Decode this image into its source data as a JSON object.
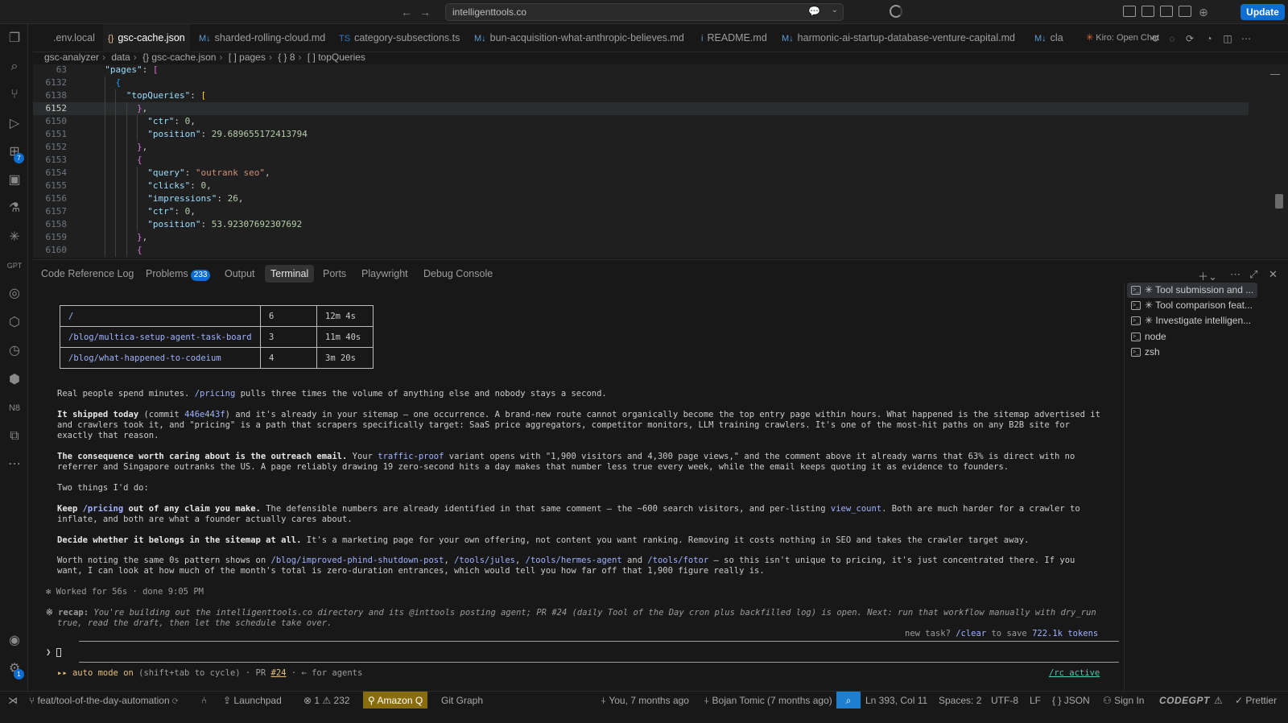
{
  "titlebar": {
    "search_text": "intelligenttools.co",
    "update_label": "Update"
  },
  "activity": {
    "extensions_badge": "7",
    "settings_badge": "1"
  },
  "tabs": [
    {
      "label": ".env.local",
      "icon": "",
      "active": false
    },
    {
      "label": "gsc-cache.json",
      "icon": "{}",
      "active": true
    },
    {
      "label": "sharded-rolling-cloud.md",
      "icon": "M↓",
      "active": false
    },
    {
      "label": "category-subsections.ts",
      "icon": "TS",
      "active": false
    },
    {
      "label": "bun-acquisition-what-anthropic-believes.md",
      "icon": "M↓",
      "active": false
    },
    {
      "label": "README.md",
      "icon": "i",
      "active": false
    },
    {
      "label": "harmonic-ai-startup-database-venture-capital.md",
      "icon": "M↓",
      "active": false
    },
    {
      "label": "cla",
      "icon": "M↓",
      "active": false
    }
  ],
  "kiro_tab": "Kiro: Open Chat",
  "breadcrumb": [
    "gsc-analyzer",
    "data",
    "{} gsc-cache.json",
    "[ ] pages",
    "{ } 8",
    "[ ] topQueries"
  ],
  "editor": {
    "lines": [
      {
        "n": "63",
        "text": "  \"pages\": ["
      },
      {
        "n": "6132",
        "text": "    {"
      },
      {
        "n": "6138",
        "text": "      \"topQueries\": ["
      },
      {
        "n": "6152",
        "text": "        },"
      },
      {
        "n": "6150",
        "text": "          \"ctr\": 0,"
      },
      {
        "n": "6151",
        "text": "          \"position\": 29.689655172413794"
      },
      {
        "n": "6152",
        "text": "        },"
      },
      {
        "n": "6153",
        "text": "        {"
      },
      {
        "n": "6154",
        "text": "          \"query\": \"outrank seo\","
      },
      {
        "n": "6155",
        "text": "          \"clicks\": 0,"
      },
      {
        "n": "6156",
        "text": "          \"impressions\": 26,"
      },
      {
        "n": "6157",
        "text": "          \"ctr\": 0,"
      },
      {
        "n": "6158",
        "text": "          \"position\": 53.92307692307692"
      },
      {
        "n": "6159",
        "text": "        },"
      },
      {
        "n": "6160",
        "text": "        {"
      }
    ]
  },
  "panel": {
    "tabs": [
      "Code Reference Log",
      "Problems",
      "Output",
      "Terminal",
      "Ports",
      "Playwright",
      "Debug Console"
    ],
    "problems_count": "233",
    "active_tab": "Terminal"
  },
  "terminal": {
    "table": [
      [
        "/",
        "6",
        "12m 4s"
      ],
      [
        "/blog/multica-setup-agent-task-board",
        "3",
        "11m 40s"
      ],
      [
        "/blog/what-happened-to-codeium",
        "4",
        "3m 20s"
      ]
    ],
    "p1_a": "Real people spend minutes. ",
    "p1_link": "/pricing",
    "p1_b": " pulls three times the volume of anything else and nobody stays a second.",
    "p2_bold": "It shipped today",
    "p2_a": " (commit ",
    "p2_commit": "446e443f",
    "p2_b": ") and it's already in your sitemap — one occurrence. A brand-new route cannot organically become the top entry page within hours. What happened is the sitemap advertised it",
    "p2_c": "and crawlers took it, and \"pricing\" is a path that scrapers specifically target: SaaS price aggregators, competitor monitors, LLM training crawlers. It's one of the most-hit paths on any B2B site for",
    "p2_d": "exactly that reason.",
    "p3_bold": "The consequence worth caring about is the outreach email.",
    "p3_a": " Your ",
    "p3_link": "traffic-proof",
    "p3_b": " variant opens with \"1,900 visitors and 4,300 page views,\" and the comment above it already warns that 63% is direct with no",
    "p3_c": "referrer and Singapore outranks the US. A page reliably drawing 19 zero-second hits a day makes that number less true every week, while the email keeps quoting it as evidence to founders.",
    "p4": "Two things I'd do:",
    "p5_bold_a": "Keep ",
    "p5_bold_link": "/pricing",
    "p5_bold_b": " out of any claim you make.",
    "p5_a": " The defensible numbers are already identified in that same comment — the ~600 search visitors, and per-listing ",
    "p5_link": "view_count",
    "p5_b": ". Both are much harder for a crawler to",
    "p5_c": "inflate, and both are what a founder actually cares about.",
    "p6_bold": "Decide whether it belongs in the sitemap at all.",
    "p6_a": " It's a marketing page for your own offering, not content you want ranking. Removing it costs nothing in SEO and takes the crawler target away.",
    "p7_a": "Worth noting the same 0s pattern shows on ",
    "p7_l1": "/blog/improved-phind-shutdown-post",
    "p7_sep1": ", ",
    "p7_l2": "/tools/jules",
    "p7_sep2": ", ",
    "p7_l3": "/tools/hermes-agent",
    "p7_and": " and ",
    "p7_l4": "/tools/fotor",
    "p7_b": " — so this isn't unique to pricing, it's just concentrated there. If you",
    "p7_c": "want, I can look at how much of the month's total is zero-duration entrances, which would tell you how far off that 1,900 figure really is.",
    "worked": "✻ Worked for 56s · done 9:05 PM",
    "recap_label": "※ recap:",
    "recap_a": " You're building out the intelligenttools.co directory and its @inttools posting agent; PR #24 (daily Tool of the Day cron plus backfilled log) is open. Next: run that workflow manually with dry_run",
    "recap_b": "true, read the draft, then let the schedule take over.",
    "newtask_a": "new task? ",
    "newtask_cmd": "/clear",
    "newtask_b": " to save ",
    "newtask_tokens": "722.1k tokens",
    "prompt": "❯",
    "mode_arrow": "▸▸",
    "mode_on": "auto mode on",
    "mode_rest": " (shift+tab to cycle) · PR ",
    "mode_pr": "#24",
    "mode_tail": " · ← for agents",
    "rc": "/rc active"
  },
  "terminal_list": [
    "✳ Tool submission and ...",
    "✳ Tool comparison feat...",
    "✳ Investigate intelligen...",
    "node",
    "zsh"
  ],
  "statusbar": {
    "branch": "feat/tool-of-the-day-automation",
    "launchpad": "Launchpad",
    "errors": "1",
    "warnings": "232",
    "amazonq": "Amazon Q",
    "gitgraph": "Git Graph",
    "blame1": "You, 7 months ago",
    "blame2": "Bojan Tomic (7 months ago)",
    "position": "Ln 393, Col 11",
    "spaces": "Spaces: 2",
    "encoding": "UTF-8",
    "eol": "LF",
    "language": "JSON",
    "signin": "Sign In",
    "codegpt": "CODEGPT",
    "prettier": "Prettier"
  }
}
